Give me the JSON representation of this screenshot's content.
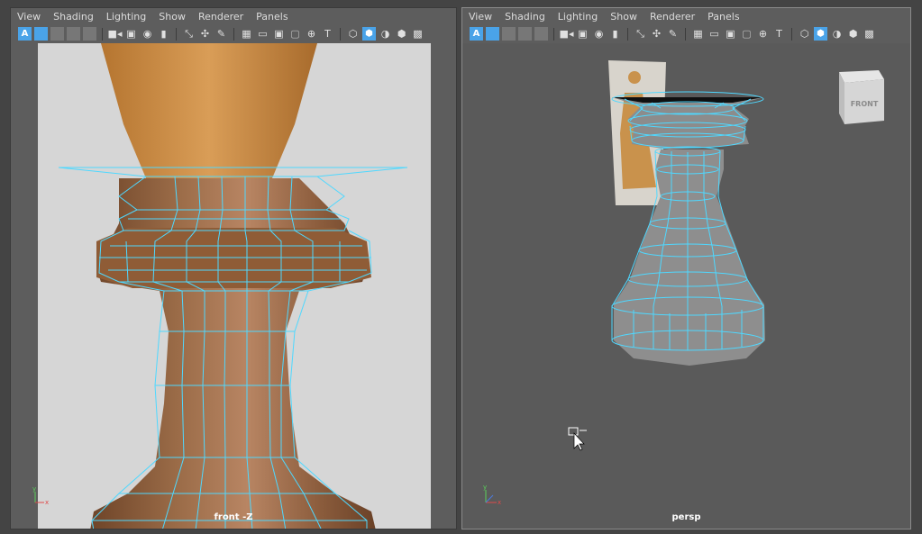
{
  "menus": [
    "View",
    "Shading",
    "Lighting",
    "Show",
    "Renderer",
    "Panels"
  ],
  "toolbar_icons": [
    "select-camera-icon",
    "frame-icon",
    "wireframe-box-icon",
    "smooth-icon",
    "lights-icon",
    "camera-icon",
    "bookmark-camera-icon",
    "film-camera-icon",
    "bookmark-icon",
    "snap-icon",
    "pivot-icon",
    "paint-icon",
    "grid-icon",
    "film-gate-icon",
    "resolution-gate-icon",
    "safe-area-icon",
    "field-chart-icon",
    "text-icon",
    "wireframe-cube-icon",
    "shaded-cube-icon",
    "lighting-sphere-icon",
    "textured-cube-icon",
    "checker-icon"
  ],
  "panels": {
    "left": {
      "camera_label": "front -Z"
    },
    "right": {
      "camera_label": "persp",
      "view_cube_label": "FRONT"
    }
  },
  "colors": {
    "wire": "#4fd8ff",
    "wood_light": "#d79a52",
    "wood_dark": "#8a5a35",
    "mesh_grey": "#8e8e8e"
  }
}
